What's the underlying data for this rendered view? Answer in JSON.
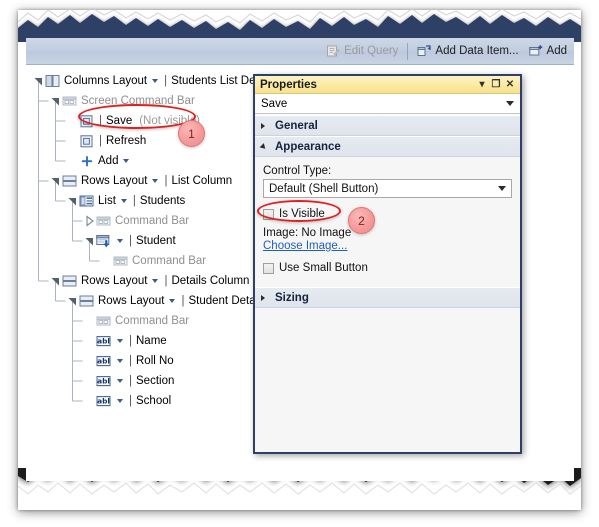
{
  "toolbar": {
    "items": [
      {
        "label": "Edit Query",
        "icon": "edit-query-icon",
        "disabled": true
      },
      {
        "label": "Add Data Item...",
        "icon": "add-data-item-icon",
        "disabled": false
      },
      {
        "label": "Add",
        "icon": "add-icon",
        "disabled": false
      }
    ]
  },
  "tree": {
    "rows": [
      {
        "indent": 0,
        "twisty": "expanded",
        "icon": "columns-layout-icon",
        "label": "Columns Layout",
        "caret": true,
        "name": "Students List Detail",
        "muted": false,
        "iconMuted": false
      },
      {
        "indent": 1,
        "twisty": "expanded",
        "icon": "command-bar-icon",
        "label": "Screen Command Bar",
        "caret": false,
        "name": "",
        "muted": true,
        "iconMuted": true
      },
      {
        "indent": 2,
        "twisty": "none",
        "icon": "shell-button-icon",
        "label": "",
        "caret": false,
        "name": "Save",
        "note": "(Not visible)",
        "muted": false,
        "iconMuted": false
      },
      {
        "indent": 2,
        "twisty": "none",
        "icon": "shell-button-icon",
        "label": "",
        "caret": false,
        "name": "Refresh",
        "muted": false,
        "iconMuted": false
      },
      {
        "indent": 2,
        "twisty": "none",
        "icon": "plus-icon",
        "label": "Add",
        "caret": true,
        "name": "",
        "muted": false,
        "iconMuted": false
      },
      {
        "indent": 1,
        "twisty": "expanded",
        "icon": "rows-layout-icon",
        "label": "Rows Layout",
        "caret": true,
        "name": "List Column",
        "muted": false,
        "iconMuted": false
      },
      {
        "indent": 2,
        "twisty": "expanded",
        "icon": "list-icon",
        "label": "List",
        "caret": true,
        "name": "Students",
        "muted": false,
        "iconMuted": false
      },
      {
        "indent": 3,
        "twisty": "collapsed",
        "icon": "command-bar-icon",
        "label": "Command Bar",
        "caret": false,
        "name": "",
        "muted": true,
        "iconMuted": true
      },
      {
        "indent": 3,
        "twisty": "expanded",
        "icon": "screen-icon",
        "label": "",
        "caret": true,
        "name": "Student",
        "muted": false,
        "iconMuted": false
      },
      {
        "indent": 4,
        "twisty": "none",
        "icon": "command-bar-icon",
        "label": "Command Bar",
        "caret": false,
        "name": "",
        "muted": true,
        "iconMuted": true
      },
      {
        "indent": 1,
        "twisty": "expanded",
        "icon": "rows-layout-icon",
        "label": "Rows Layout",
        "caret": true,
        "name": "Details Column",
        "muted": false,
        "iconMuted": false
      },
      {
        "indent": 2,
        "twisty": "expanded",
        "icon": "rows-layout-icon",
        "label": "Rows Layout",
        "caret": true,
        "name": "Student Details",
        "muted": false,
        "iconMuted": false
      },
      {
        "indent": 3,
        "twisty": "none",
        "icon": "command-bar-icon",
        "label": "Command Bar",
        "caret": false,
        "name": "",
        "muted": true,
        "iconMuted": true
      },
      {
        "indent": 3,
        "twisty": "none",
        "icon": "text-field-icon",
        "label": "",
        "caret": true,
        "name": "Name",
        "muted": false,
        "iconMuted": false
      },
      {
        "indent": 3,
        "twisty": "none",
        "icon": "text-field-icon",
        "label": "",
        "caret": true,
        "name": "Roll No",
        "muted": false,
        "iconMuted": false
      },
      {
        "indent": 3,
        "twisty": "none",
        "icon": "text-field-icon",
        "label": "",
        "caret": true,
        "name": "Section",
        "muted": false,
        "iconMuted": false
      },
      {
        "indent": 3,
        "twisty": "none",
        "icon": "text-field-icon",
        "label": "",
        "caret": true,
        "name": "School",
        "muted": false,
        "iconMuted": false
      }
    ]
  },
  "properties": {
    "title": "Properties",
    "minimize_glyph": "▾",
    "maximize_glyph": "❐",
    "close_glyph": "✕",
    "selected_object": "Save",
    "sections": {
      "general": {
        "label": "General",
        "expanded": false
      },
      "appearance": {
        "label": "Appearance",
        "expanded": true,
        "control_type_label": "Control Type:",
        "control_type_value": "Default (Shell Button)",
        "is_visible_label": "Is Visible",
        "is_visible_checked": false,
        "image_label": "Image: No Image",
        "choose_image_link": "Choose Image...",
        "use_small_button_label": "Use Small Button",
        "use_small_button_checked": false
      },
      "sizing": {
        "label": "Sizing",
        "expanded": false
      }
    }
  },
  "annotations": {
    "badges": [
      {
        "number": "1"
      },
      {
        "number": "2"
      }
    ]
  },
  "colors": {
    "accent_navy": "#2f3f66",
    "title_yellow": "#fbeaa0",
    "toolbar_blue": "#c2cee0",
    "annotation_red": "#e02020",
    "link_blue": "#1f5fbf"
  }
}
